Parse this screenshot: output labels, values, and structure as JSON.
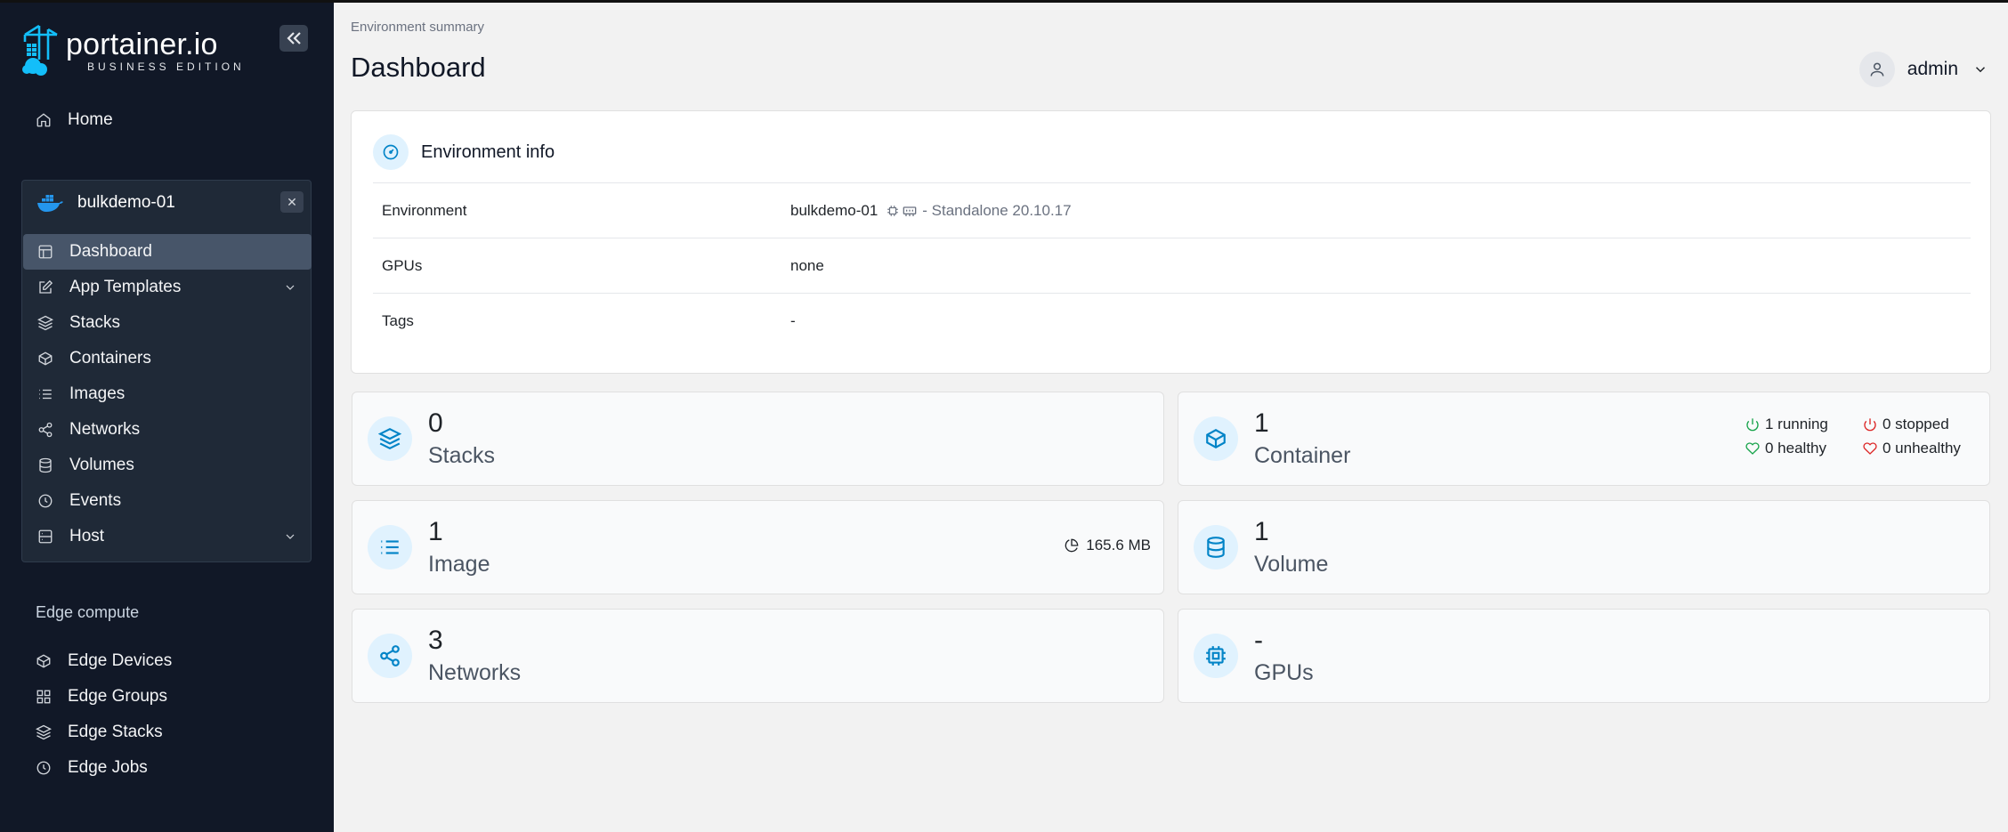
{
  "brand": {
    "name": "portainer.io",
    "edition": "BUSINESS EDITION"
  },
  "sidebar": {
    "home": "Home",
    "environment": {
      "name": "bulkdemo-01",
      "items": [
        {
          "label": "Dashboard",
          "icon": "dashboard-icon",
          "active": true
        },
        {
          "label": "App Templates",
          "icon": "edit-icon",
          "expandable": true
        },
        {
          "label": "Stacks",
          "icon": "layers-icon"
        },
        {
          "label": "Containers",
          "icon": "box-icon"
        },
        {
          "label": "Images",
          "icon": "list-icon"
        },
        {
          "label": "Networks",
          "icon": "share-icon"
        },
        {
          "label": "Volumes",
          "icon": "database-icon"
        },
        {
          "label": "Events",
          "icon": "clock-icon"
        },
        {
          "label": "Host",
          "icon": "server-icon",
          "expandable": true
        }
      ]
    },
    "edge": {
      "title": "Edge compute",
      "items": [
        {
          "label": "Edge Devices",
          "icon": "box-icon"
        },
        {
          "label": "Edge Groups",
          "icon": "grid-icon"
        },
        {
          "label": "Edge Stacks",
          "icon": "layers-icon"
        },
        {
          "label": "Edge Jobs",
          "icon": "clock-icon"
        }
      ]
    }
  },
  "header": {
    "breadcrumb": "Environment summary",
    "title": "Dashboard",
    "user": "admin"
  },
  "env_info": {
    "title": "Environment info",
    "rows": [
      {
        "key": "Environment",
        "value": "bulkdemo-01",
        "detail": "- Standalone 20.10.17"
      },
      {
        "key": "GPUs",
        "value": "none"
      },
      {
        "key": "Tags",
        "value": "-"
      }
    ]
  },
  "stats": {
    "stacks": {
      "count": "0",
      "label": "Stacks"
    },
    "containers": {
      "count": "1",
      "label": "Container",
      "running": "1 running",
      "stopped": "0 stopped",
      "healthy": "0 healthy",
      "unhealthy": "0 unhealthy"
    },
    "images": {
      "count": "1",
      "label": "Image",
      "size": "165.6 MB"
    },
    "volumes": {
      "count": "1",
      "label": "Volume"
    },
    "networks": {
      "count": "3",
      "label": "Networks"
    },
    "gpus": {
      "count": "-",
      "label": "GPUs"
    }
  },
  "colors": {
    "sidebar": "#111827",
    "accent": "#0284c7",
    "running": "#16a34a",
    "stopped": "#dc2626"
  }
}
